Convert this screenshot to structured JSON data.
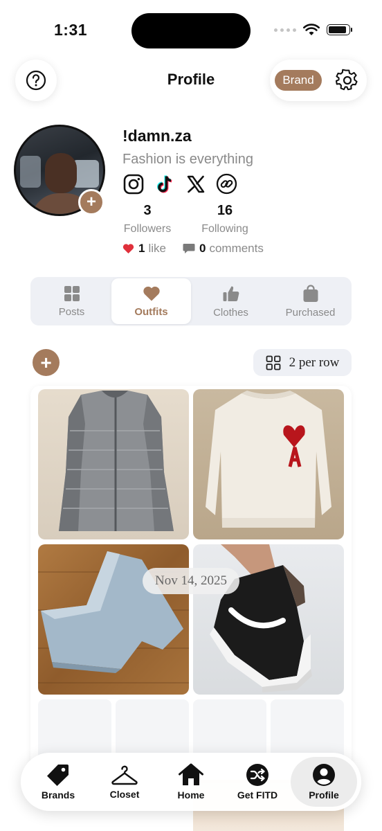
{
  "status_bar": {
    "time": "1:31",
    "battery_level": 0.9
  },
  "header": {
    "title": "Profile",
    "badge_label": "Brand"
  },
  "colors": {
    "accent": "#a47b5d",
    "like_heart": "#e0303b"
  },
  "profile": {
    "username": "!damn.za",
    "bio": "Fashion is everything",
    "socials": [
      "instagram-icon",
      "tiktok-icon",
      "x-icon",
      "link-icon"
    ],
    "followers": {
      "count": "3",
      "label": "Followers"
    },
    "following": {
      "count": "16",
      "label": "Following"
    },
    "likes": {
      "count": "1",
      "label": "like"
    },
    "comments": {
      "count": "0",
      "label": "comments"
    }
  },
  "tabs": [
    {
      "label": "Posts",
      "icon": "grid-icon",
      "active": false
    },
    {
      "label": "Outfits",
      "icon": "heart-icon",
      "active": true
    },
    {
      "label": "Clothes",
      "icon": "thumbs-up-icon",
      "active": false
    },
    {
      "label": "Purchased",
      "icon": "bag-icon",
      "active": false
    }
  ],
  "grid_controls": {
    "per_row_label": "2 per row"
  },
  "outfit": {
    "date": "Nov 14, 2025",
    "items": [
      "puffer-vest",
      "white-sweater",
      "jeans",
      "sneakers"
    ]
  },
  "bottom_nav": [
    {
      "label": "Brands",
      "icon": "tag-icon",
      "active": false
    },
    {
      "label": "Closet",
      "icon": "hanger-icon",
      "active": false
    },
    {
      "label": "Home",
      "icon": "home-icon",
      "active": false
    },
    {
      "label": "Get FITD",
      "icon": "shuffle-icon",
      "active": false
    },
    {
      "label": "Profile",
      "icon": "person-icon",
      "active": true
    }
  ]
}
